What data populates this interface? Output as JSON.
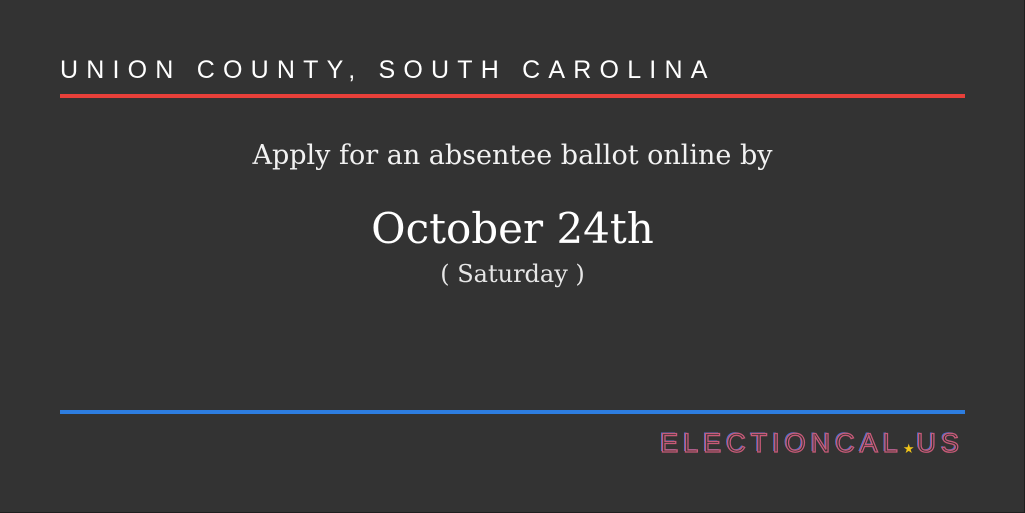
{
  "header": {
    "title": "UNION COUNTY, SOUTH CAROLINA"
  },
  "main": {
    "prompt": "Apply for an absentee ballot online by",
    "date": "October 24th",
    "weekday": "( Saturday )"
  },
  "brand": {
    "name_left": "ELECTIONCAL",
    "separator_icon": "star-icon",
    "separator_glyph": "★",
    "name_right": "US"
  },
  "colors": {
    "background": "#333333",
    "red_rule": "#e8403a",
    "blue_rule": "#2d7de0",
    "brand_red": "#c85a78",
    "brand_blue": "#4a6fd0",
    "star": "#f0c419"
  }
}
